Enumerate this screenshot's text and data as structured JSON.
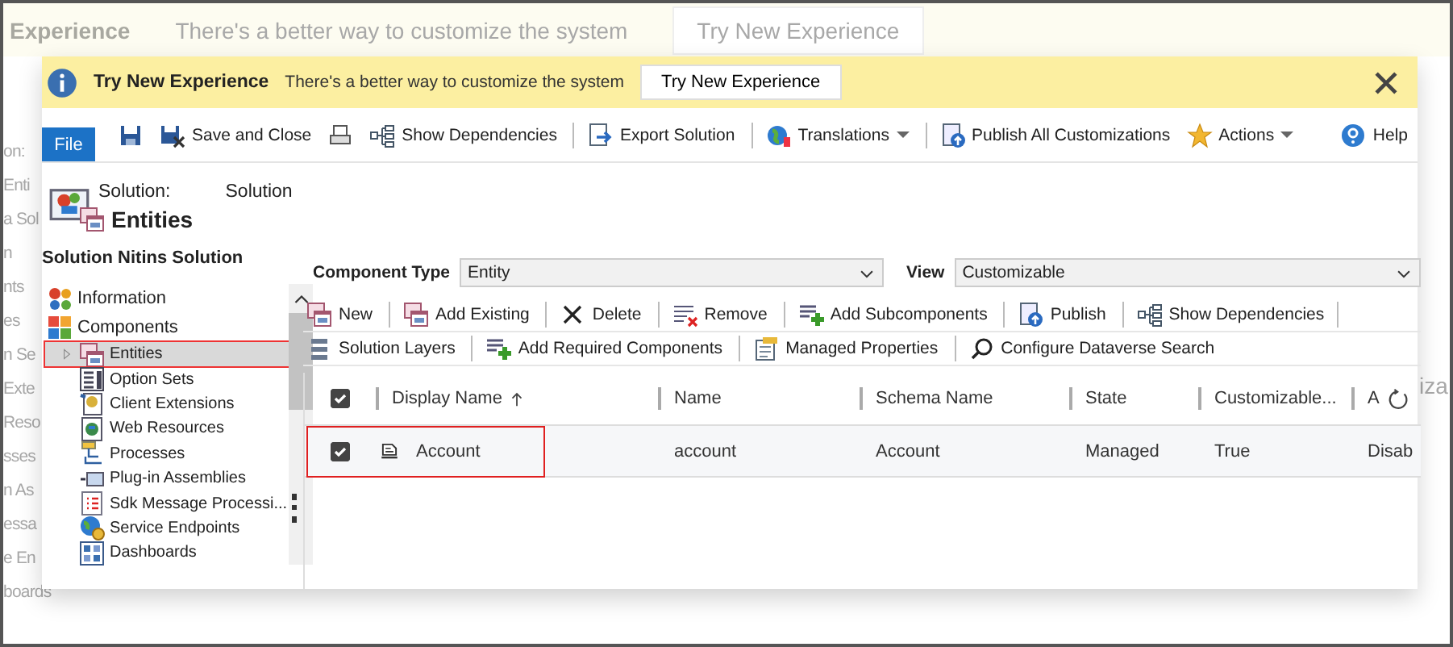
{
  "background": {
    "banner": {
      "title": "Experience",
      "message": "There's a better way to customize the system",
      "button": "Try New Experience"
    },
    "sidebar_fragments": [
      "on:",
      "Enti",
      "a Sol",
      "n",
      "nts",
      "es",
      "n Se",
      "Exte",
      "Reso",
      "sses",
      "n As",
      "essa",
      "e En",
      "boards"
    ],
    "grid_fragment": "iza"
  },
  "banner": {
    "title": "Try New Experience",
    "message": "There's a better way to customize the system",
    "button": "Try New Experience"
  },
  "ribbon": {
    "file_tab": "File",
    "help": "Help",
    "items": [
      {
        "kind": "icon",
        "separator": false,
        "dropdown": false
      },
      {
        "kind": "command",
        "label": "Save and Close",
        "separator": false,
        "dropdown": false
      },
      {
        "kind": "icon",
        "separator": false,
        "dropdown": false
      },
      {
        "kind": "command",
        "label": "Show Dependencies",
        "separator": false,
        "dropdown": false
      },
      {
        "kind": "command",
        "label": "Export Solution",
        "separator": true,
        "dropdown": false
      },
      {
        "kind": "command",
        "label": "Translations",
        "separator": true,
        "dropdown": true
      },
      {
        "kind": "command",
        "label": "Publish All Customizations",
        "separator": true,
        "dropdown": false
      },
      {
        "kind": "command",
        "label": "Actions",
        "separator": false,
        "dropdown": true
      }
    ]
  },
  "header": {
    "solution_label": "Solution:",
    "solution_name": "Solution",
    "title": "Entities",
    "subtitle": "Solution Nitins Solution"
  },
  "nav": {
    "items": [
      {
        "label": "Information",
        "selected": false
      },
      {
        "label": "Components",
        "selected": false,
        "children": [
          {
            "label": "Entities",
            "selected": true,
            "expandable": true
          },
          {
            "label": "Option Sets",
            "selected": false,
            "expandable": false
          },
          {
            "label": "Client Extensions",
            "selected": false,
            "expandable": false
          },
          {
            "label": "Web Resources",
            "selected": false,
            "expandable": false
          },
          {
            "label": "Processes",
            "selected": false,
            "expandable": false
          },
          {
            "label": "Plug-in Assemblies",
            "selected": false,
            "expandable": false
          },
          {
            "label": "Sdk Message Processi...",
            "selected": false,
            "expandable": false
          },
          {
            "label": "Service Endpoints",
            "selected": false,
            "expandable": false
          },
          {
            "label": "Dashboards",
            "selected": false,
            "expandable": false
          }
        ]
      }
    ]
  },
  "filters": [
    {
      "label": "Component Type",
      "value": "Entity"
    },
    {
      "label": "View",
      "value": "Customizable"
    }
  ],
  "commands": [
    [
      {
        "label": "New",
        "separator": false
      },
      {
        "label": "Add Existing",
        "separator": true
      },
      {
        "label": "Delete",
        "separator": true
      },
      {
        "label": "Remove",
        "separator": true
      },
      {
        "label": "Add Subcomponents",
        "separator": true
      },
      {
        "label": "Publish",
        "separator": true
      },
      {
        "label": "Show Dependencies",
        "separator": true
      }
    ],
    [
      {
        "label": "Solution Layers",
        "separator": false
      },
      {
        "label": "Add Required Components",
        "separator": true
      },
      {
        "label": "Managed Properties",
        "separator": true
      },
      {
        "label": "Configure Dataverse Search",
        "separator": true
      }
    ]
  ],
  "grid": {
    "all_checked": true,
    "columns": [
      {
        "label": "Display Name",
        "sorted": true
      },
      {
        "label": "Name",
        "sorted": false
      },
      {
        "label": "Schema Name",
        "sorted": false
      },
      {
        "label": "State",
        "sorted": false
      },
      {
        "label": "Customizable...",
        "sorted": false
      },
      {
        "label": "A",
        "sorted": false
      }
    ],
    "rows": [
      {
        "checked": true,
        "selected": true,
        "cells": [
          "Account",
          "account",
          "Account",
          "Managed",
          "True",
          "Disab"
        ]
      }
    ]
  }
}
